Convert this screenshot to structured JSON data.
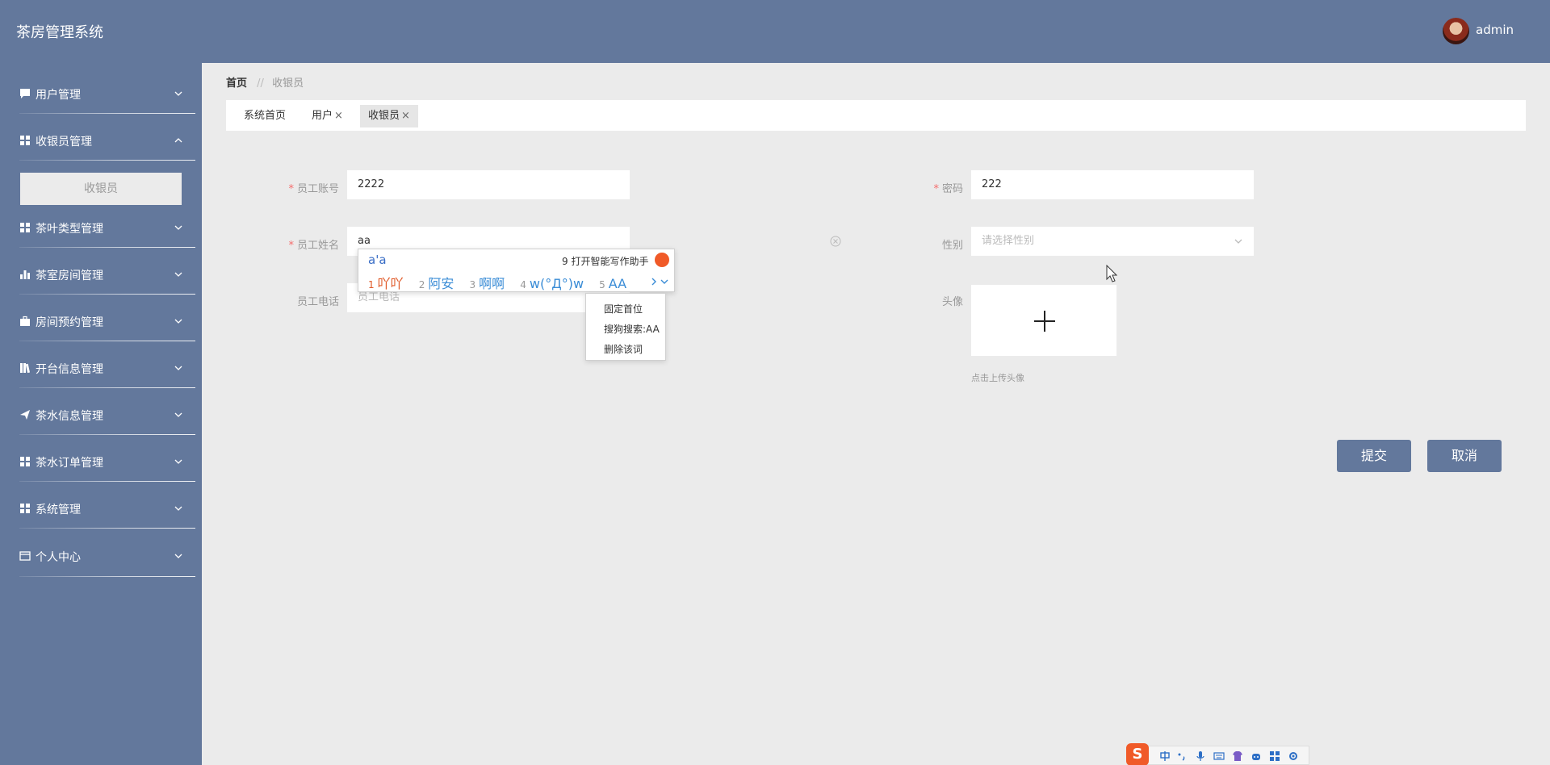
{
  "header": {
    "title": "茶房管理系统",
    "username": "admin"
  },
  "sidebar": {
    "items": [
      {
        "label": "用户管理",
        "icon": "chat-icon"
      },
      {
        "label": "收银员管理",
        "icon": "grid-icon"
      },
      {
        "label": "茶叶类型管理",
        "icon": "grid-icon"
      },
      {
        "label": "茶室房间管理",
        "icon": "bar-chart-icon"
      },
      {
        "label": "房间预约管理",
        "icon": "briefcase-icon"
      },
      {
        "label": "开台信息管理",
        "icon": "books-icon"
      },
      {
        "label": "茶水信息管理",
        "icon": "send-icon"
      },
      {
        "label": "茶水订单管理",
        "icon": "grid-icon"
      },
      {
        "label": "系统管理",
        "icon": "grid-icon"
      },
      {
        "label": "个人中心",
        "icon": "card-icon"
      }
    ],
    "sub_item": "收银员"
  },
  "breadcrumb": {
    "home": "首页",
    "separator": "//",
    "current": "收银员"
  },
  "tabs": [
    {
      "label": "系统首页"
    },
    {
      "label": "用户"
    },
    {
      "label": "收银员"
    }
  ],
  "form": {
    "account_label": "员工账号",
    "account_value": "2222",
    "password_label": "密码",
    "password_value": "222",
    "name_label": "员工姓名",
    "name_value": "aa",
    "gender_label": "性别",
    "gender_placeholder": "请选择性别",
    "phone_label": "员工电话",
    "phone_placeholder": "员工电话",
    "avatar_label": "头像",
    "avatar_hint": "点击上传头像",
    "submit_label": "提交",
    "cancel_label": "取消"
  },
  "ime": {
    "composition": "a'a",
    "assist_label": "9 打开智能写作助手",
    "candidates": [
      {
        "num": "1",
        "text": "吖吖"
      },
      {
        "num": "2",
        "text": "阿安"
      },
      {
        "num": "3",
        "text": "啊啊"
      },
      {
        "num": "4",
        "text": "w(°Д°)w"
      },
      {
        "num": "5",
        "text": "AA"
      }
    ],
    "context_menu": [
      "固定首位",
      "搜狗搜索:AA",
      "删除该词"
    ],
    "status_logo": "S"
  },
  "colors": {
    "primary": "#63789c",
    "background": "#ebebeb",
    "required": "#f56c6c"
  }
}
